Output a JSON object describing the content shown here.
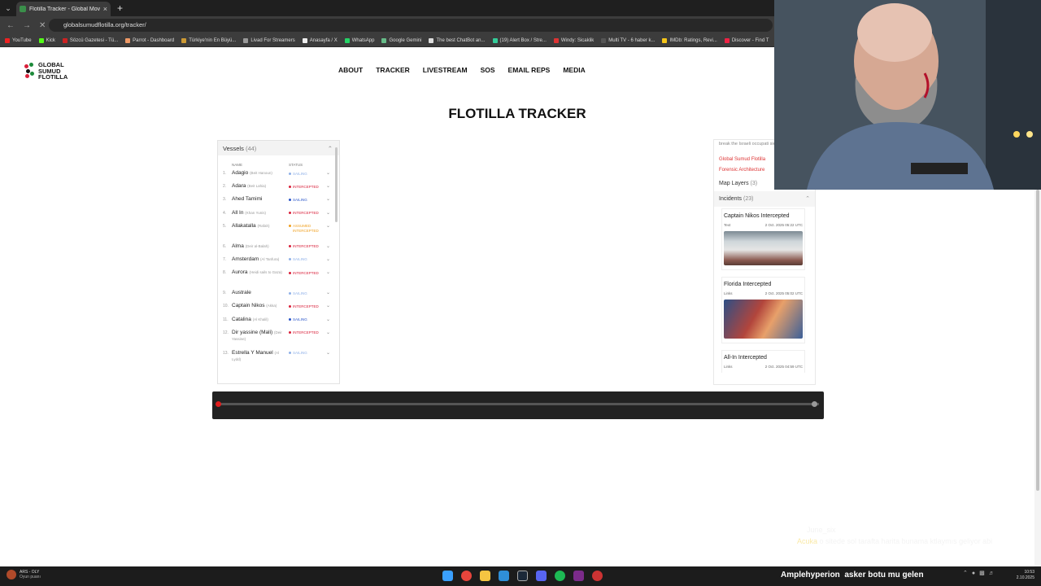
{
  "browser": {
    "tab_title": "Flotilla Tracker - Global Movem",
    "url": "globalsumudflotilla.org/tracker/",
    "bookmarks": [
      "YouTube",
      "Kick",
      "Sözcü Gazetesi - Tü...",
      "Parrot - Dashboard",
      "Türkiye'nin En Büyü...",
      "Livad For Streamers",
      "Anasayfa / X",
      "WhatsApp",
      "Google Gemini",
      "The best ChatBot an...",
      "(19) Alert Box / Stre...",
      "Windy: Sicaklik",
      "Multi TV - 6 haber k...",
      "IMDb: Ratings, Revi...",
      "Discover - Find T"
    ]
  },
  "site": {
    "logo": [
      "GLOBAL",
      "SUMUD",
      "FLOTILLA"
    ],
    "nav": [
      "ABOUT",
      "TRACKER",
      "LIVESTREAM",
      "SOS",
      "EMAIL REPS",
      "MEDIA"
    ],
    "title": "FLOTILLA TRACKER"
  },
  "vessels": {
    "header": "Vessels",
    "count": "(44)",
    "col_name": "NAME",
    "col_status": "STATUS",
    "rows": [
      {
        "n": "1.",
        "name": "Adagio",
        "alt": "(Beit Hanoun)",
        "status": "SAILING",
        "color": "#8fb0e8"
      },
      {
        "n": "2.",
        "name": "Adara",
        "alt": "(Beit Lahia)",
        "status": "INTERCEPTED",
        "color": "#d9203a"
      },
      {
        "n": "3.",
        "name": "Ahed Tamimi",
        "alt": "",
        "status": "SAILING",
        "color": "#2a55c9"
      },
      {
        "n": "4.",
        "name": "All In",
        "alt": "(Khan Yunis)",
        "status": "INTERCEPTED",
        "color": "#d9203a"
      },
      {
        "n": "5.",
        "name": "Allakatalla",
        "alt": "(Rafah)",
        "status": "ASSUMED INTERCEPTED",
        "color": "#f0a020"
      },
      {
        "n": "6.",
        "name": "Alma",
        "alt": "(Deir al-Balah)",
        "status": "INTERCEPTED",
        "color": "#d9203a"
      },
      {
        "n": "7.",
        "name": "Amsterdam",
        "alt": "(Al Tanfura)",
        "status": "SAILING",
        "color": "#8fb0e8"
      },
      {
        "n": "8.",
        "name": "Aurora",
        "alt": "(Heidi sails to Gaza)",
        "status": "INTERCEPTED",
        "color": "#d9203a"
      },
      {
        "n": "9.",
        "name": "Australe",
        "alt": "",
        "status": "SAILING",
        "color": "#8fb0e8"
      },
      {
        "n": "10.",
        "name": "Captain Nikos",
        "alt": "(Akka)",
        "status": "INTERCEPTED",
        "color": "#d9203a"
      },
      {
        "n": "11.",
        "name": "Catalina",
        "alt": "(Al Khalil)",
        "status": "SAILING",
        "color": "#2a55c9"
      },
      {
        "n": "12.",
        "name": "Dir yassine (Mali)",
        "alt": "(Deir Yassine)",
        "status": "INTERCEPTED",
        "color": "#d9203a"
      },
      {
        "n": "13.",
        "name": "Estrella Y Manuel",
        "alt": "(Al Lydd)",
        "status": "SAILING",
        "color": "#8fb0e8"
      }
    ]
  },
  "info_panel": {
    "truncated_text": "break the Israeli occupati siege on Gaza.",
    "links": [
      "Global Sumud Flotilla",
      "Forensic Architecture"
    ],
    "map_layers": "Map Layers",
    "map_layers_count": "(3)",
    "incidents": "Incidents",
    "incidents_count": "(23)",
    "cards": [
      {
        "title": "Captain Nikos Intercepted",
        "tag": "Text",
        "time": "2 Oct. 2025 05:22 UTC"
      },
      {
        "title": "Florida Intercepted",
        "tag": "Links",
        "time": "2 Oct. 2025 05:02 UTC"
      },
      {
        "title": "All-In Intercepted",
        "tag": "Links",
        "time": "2 Oct. 2025 04:59 UTC"
      }
    ]
  },
  "overlay": {
    "chat_user": "June_six",
    "chat_user2": "Acuka",
    "chat_msg": "o sitede sol tarafta harita bunama ktlaymıs geliyor abi",
    "ticker_user": "Amplehyperion",
    "ticker_msg": "asker botu mu gelen"
  },
  "taskbar": {
    "game_title": "ARS - OLY",
    "game_sub": "Oyun puanı",
    "time": "10:53",
    "date": "2.10.2025"
  }
}
